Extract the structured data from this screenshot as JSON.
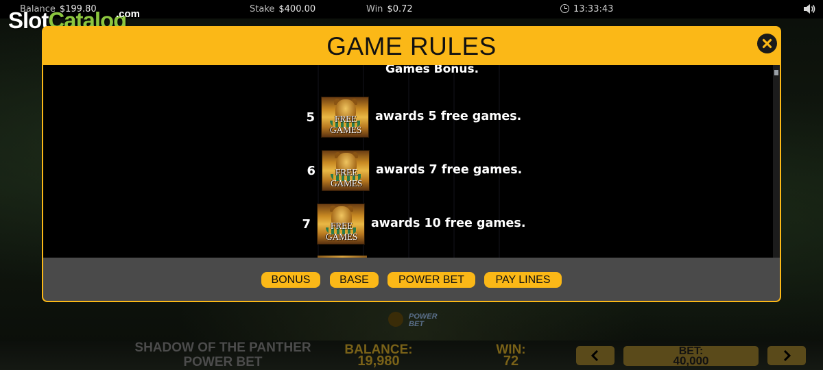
{
  "topbar": {
    "balance_label": "Balance",
    "balance_value": "$199.80",
    "stake_label": "Stake",
    "stake_value": "$400.00",
    "win_label": "Win",
    "win_value": "$0.72",
    "clock": "13:33:43",
    "clock_icon": "clock-icon",
    "sound_icon": "speaker-icon"
  },
  "watermark": {
    "part1": "Slot",
    "part2": "Catalog",
    "part3": ".com"
  },
  "modal": {
    "title": "GAME RULES",
    "close_icon": "close-icon",
    "intro_tail": "Games Bonus.",
    "rules": [
      {
        "count": "5",
        "icon_label": "FREE GAMES",
        "text": "awards 5 free games."
      },
      {
        "count": "6",
        "icon_label": "FREE GAMES",
        "text": "awards 7 free games."
      },
      {
        "count": "7",
        "icon_label": "FREE GAMES",
        "text": "awards 10 free games."
      }
    ],
    "tabs": [
      "BONUS",
      "BASE",
      "POWER BET",
      "PAY LINES"
    ]
  },
  "bottom": {
    "game_title_line1": "SHADOW OF THE PANTHER",
    "game_title_line2": "POWER BET",
    "balance_label": "BALANCE:",
    "balance_value": "19,980",
    "win_label": "WIN:",
    "win_value": "72",
    "bet_label": "BET:",
    "bet_value": "40,000",
    "prev_icon": "chevron-left-icon",
    "next_icon": "chevron-right-icon",
    "power_logo_line1": "POWER",
    "power_logo_line2": "BET"
  },
  "colors": {
    "accent": "#fbb817",
    "footer": "#4a4a4a",
    "content_bg": "#000000"
  }
}
